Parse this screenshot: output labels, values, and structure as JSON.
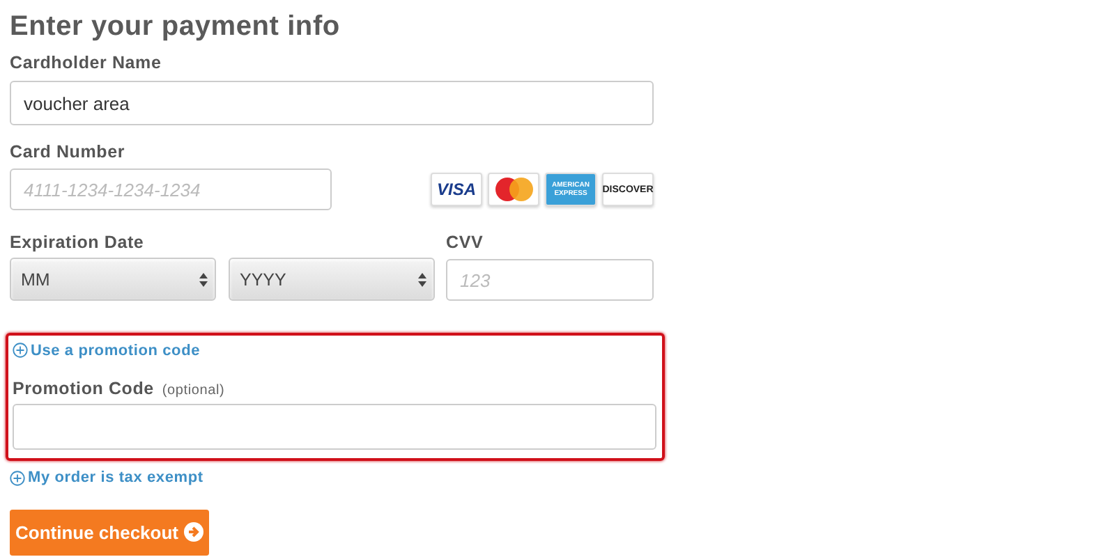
{
  "title": "Enter your payment info",
  "cardholder": {
    "label": "Cardholder Name",
    "value": "voucher area"
  },
  "card_number": {
    "label": "Card Number",
    "placeholder": "4111-1234-1234-1234"
  },
  "card_logos": [
    {
      "kind": "visa",
      "text": "VISA"
    },
    {
      "kind": "mastercard"
    },
    {
      "kind": "amex",
      "text": "AMERICAN EXPRESS"
    },
    {
      "kind": "discover",
      "text": "DISCOVER"
    }
  ],
  "expiration": {
    "label": "Expiration Date",
    "month": "MM",
    "year": "YYYY"
  },
  "cvv": {
    "label": "CVV",
    "placeholder": "123"
  },
  "promotion": {
    "highlighted": true,
    "link": "Use a promotion code",
    "label": "Promotion Code",
    "note": "(optional)"
  },
  "tax_link": "My order is tax exempt",
  "submit": "Continue checkout"
}
